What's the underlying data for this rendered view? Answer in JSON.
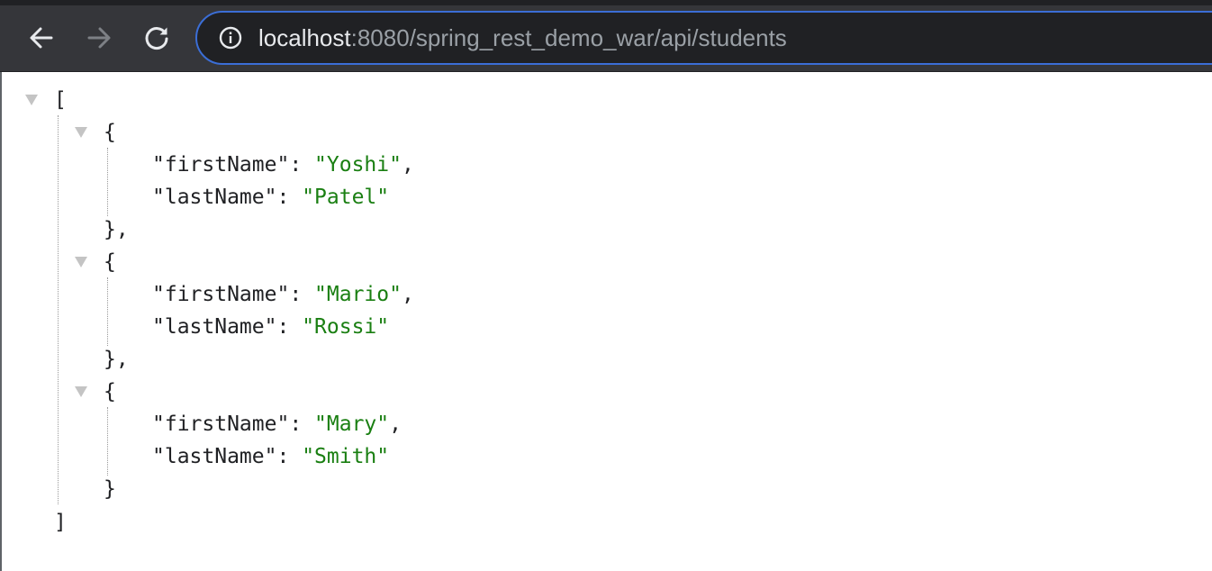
{
  "browser": {
    "url_host": "localhost",
    "url_path": ":8080/spring_rest_demo_war/api/students",
    "icons": {
      "back": "arrow-left-icon",
      "forward": "arrow-right-icon",
      "reload": "reload-icon",
      "site_info": "info-icon"
    }
  },
  "json_view": {
    "open_array": "[",
    "close_array": "]",
    "open_object": "{",
    "close_object": "}",
    "close_object_comma": "},",
    "students": [
      {
        "first_key": "\"firstName\"",
        "first_value": "\"Yoshi\"",
        "last_key": "\"lastName\"",
        "last_value": "\"Patel\""
      },
      {
        "first_key": "\"firstName\"",
        "first_value": "\"Mario\"",
        "last_key": "\"lastName\"",
        "last_value": "\"Rossi\""
      },
      {
        "first_key": "\"firstName\"",
        "first_value": "\"Mary\"",
        "last_key": "\"lastName\"",
        "last_value": "\"Smith\""
      }
    ],
    "colors": {
      "string_value": "#1a7f12",
      "key": "#202124",
      "toggle": "#c4c4c4"
    }
  }
}
